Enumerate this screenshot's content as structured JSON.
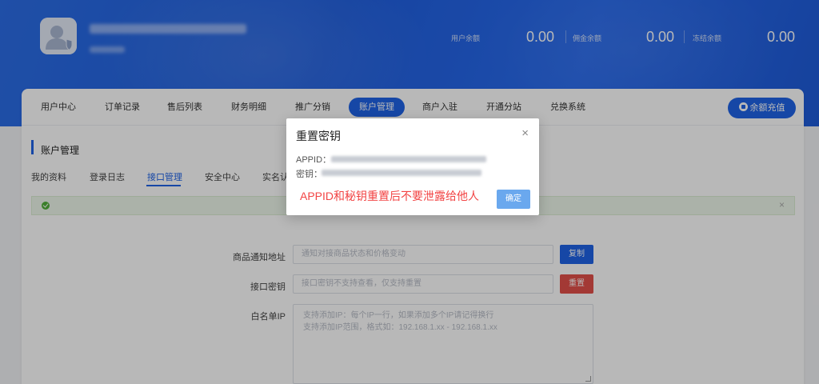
{
  "balances": [
    {
      "label": "用户余额",
      "value": "0.00"
    },
    {
      "label": "佣金余额",
      "value": "0.00"
    },
    {
      "label": "冻结余额",
      "value": "0.00"
    }
  ],
  "nav": {
    "items": [
      {
        "label": "用户中心"
      },
      {
        "label": "订单记录"
      },
      {
        "label": "售后列表"
      },
      {
        "label": "财务明细"
      },
      {
        "label": "推广分销"
      },
      {
        "label": "账户管理",
        "active": true
      },
      {
        "label": "商户入驻"
      },
      {
        "label": "开通分站"
      },
      {
        "label": "兑换系统"
      }
    ],
    "recharge_label": "余额充值"
  },
  "section": {
    "title": "账户管理",
    "tabs": [
      {
        "label": "我的资料"
      },
      {
        "label": "登录日志"
      },
      {
        "label": "接口管理",
        "active": true
      },
      {
        "label": "安全中心"
      },
      {
        "label": "实名认"
      }
    ]
  },
  "alert": {
    "close": "×"
  },
  "form": {
    "notify_url": {
      "label": "商品通知地址",
      "placeholder": "通知对接商品状态和价格变动",
      "button": "复制"
    },
    "api_secret": {
      "label": "接口密钥",
      "placeholder": "接口密钥不支持查看，仅支持重置",
      "button": "重置"
    },
    "whitelist": {
      "label": "白名单IP",
      "placeholder_line1": "支持添加IP：每个IP一行，如果添加多个IP请记得换行",
      "placeholder_line2": "支持添加IP范围，格式如：192.168.1.xx - 192.168.1.xx"
    }
  },
  "modal": {
    "title": "重置密钥",
    "close": "×",
    "appid_label": "APPID：",
    "secret_label": "密钥：",
    "warning": "APPID和秘钥重置后不要泄露给他人",
    "ok_button": "确定"
  },
  "colors": {
    "primary": "#1f63e6",
    "danger": "#e2504a",
    "warning_text": "#f24444",
    "ok_button": "#6aa8ee"
  }
}
